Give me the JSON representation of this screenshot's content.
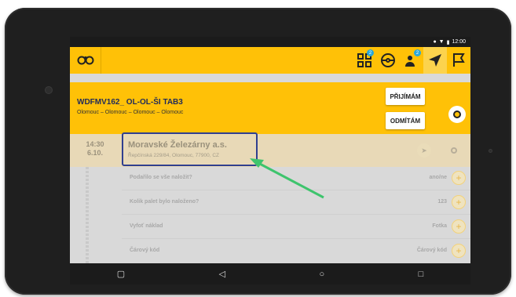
{
  "status_bar": {
    "time": "12:00"
  },
  "app_bar": {
    "icons": [
      "app-logo-icon",
      "qr-code-icon",
      "steering-wheel-icon",
      "driver-message-icon",
      "navigation-arrow-icon",
      "flag-message-icon"
    ],
    "badges": {
      "qr": "2",
      "driver": "2"
    }
  },
  "order": {
    "code": "WDFMV162_ OL-OL-ŠI TAB3",
    "route": "Olomouc – Olomouc – Olomouc – Olomouc",
    "accept_label": "PŘIJÍMÁM",
    "decline_label": "ODMÍTÁM"
  },
  "stop": {
    "time": "14:30",
    "date": "6.10.",
    "company": "Moravské Železárny a.s.",
    "address": "Řepčínská 229/84, Olomouc, 77900, CZ"
  },
  "tasks": [
    {
      "label": "Podařilo se vše naložit?",
      "value": "ano/ne"
    },
    {
      "label": "Kolik palet bylo naloženo?",
      "value": "123"
    },
    {
      "label": "Vyfoť náklad",
      "value": "Fotka"
    },
    {
      "label": "Čárový kód",
      "value": "Čárový kód"
    }
  ],
  "colors": {
    "accent": "#ffc107",
    "highlight": "#2f3f8f",
    "arrow": "#3ec46d"
  }
}
